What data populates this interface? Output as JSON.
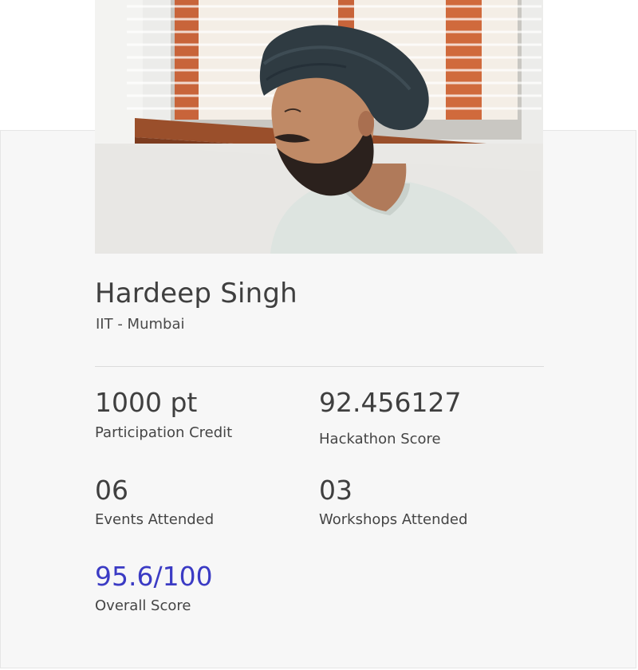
{
  "profile": {
    "name": "Hardeep Singh",
    "affiliation": "IIT - Mumbai",
    "photo_alt": "profile-photo"
  },
  "stats": {
    "participation_credit": {
      "value": "1000 pt",
      "label": "Participation Credit"
    },
    "hackathon_score": {
      "value": "92.456127",
      "label": "Hackathon Score"
    },
    "events_attended": {
      "value": "06",
      "label": "Events Attended"
    },
    "workshops_attended": {
      "value": "03",
      "label": "Workshops Attended"
    },
    "overall_score": {
      "value": "95.6/100",
      "label": "Overall Score"
    }
  },
  "colors": {
    "accent": "#3b3bc4",
    "card_background": "#f7f7f7",
    "text": "#3f3f3f"
  }
}
